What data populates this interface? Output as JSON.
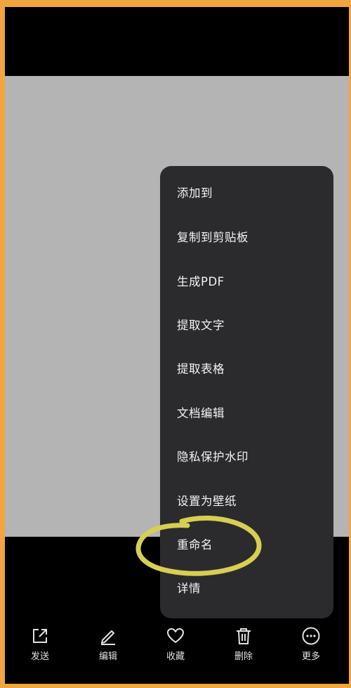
{
  "menu": {
    "items": [
      {
        "label": "添加到"
      },
      {
        "label": "复制到剪贴板"
      },
      {
        "label": "生成PDF"
      },
      {
        "label": "提取文字"
      },
      {
        "label": "提取表格"
      },
      {
        "label": "文档编辑"
      },
      {
        "label": "隐私保护水印"
      },
      {
        "label": "设置为壁纸"
      },
      {
        "label": "重命名"
      },
      {
        "label": "详情"
      }
    ],
    "highlighted_item": "重命名"
  },
  "toolbar": {
    "items": [
      {
        "label": "发送",
        "icon": "share-icon"
      },
      {
        "label": "编辑",
        "icon": "pencil-icon"
      },
      {
        "label": "收藏",
        "icon": "heart-icon"
      },
      {
        "label": "删除",
        "icon": "trash-icon"
      },
      {
        "label": "更多",
        "icon": "more-icon"
      }
    ]
  },
  "colors": {
    "frame": "#f0a640",
    "screen_background": "#000000",
    "preview_background": "#b4b4b4",
    "menu_background": "#2b2b2e",
    "menu_text": "#f2f2f2",
    "highlight_stroke": "#d6cf52"
  }
}
